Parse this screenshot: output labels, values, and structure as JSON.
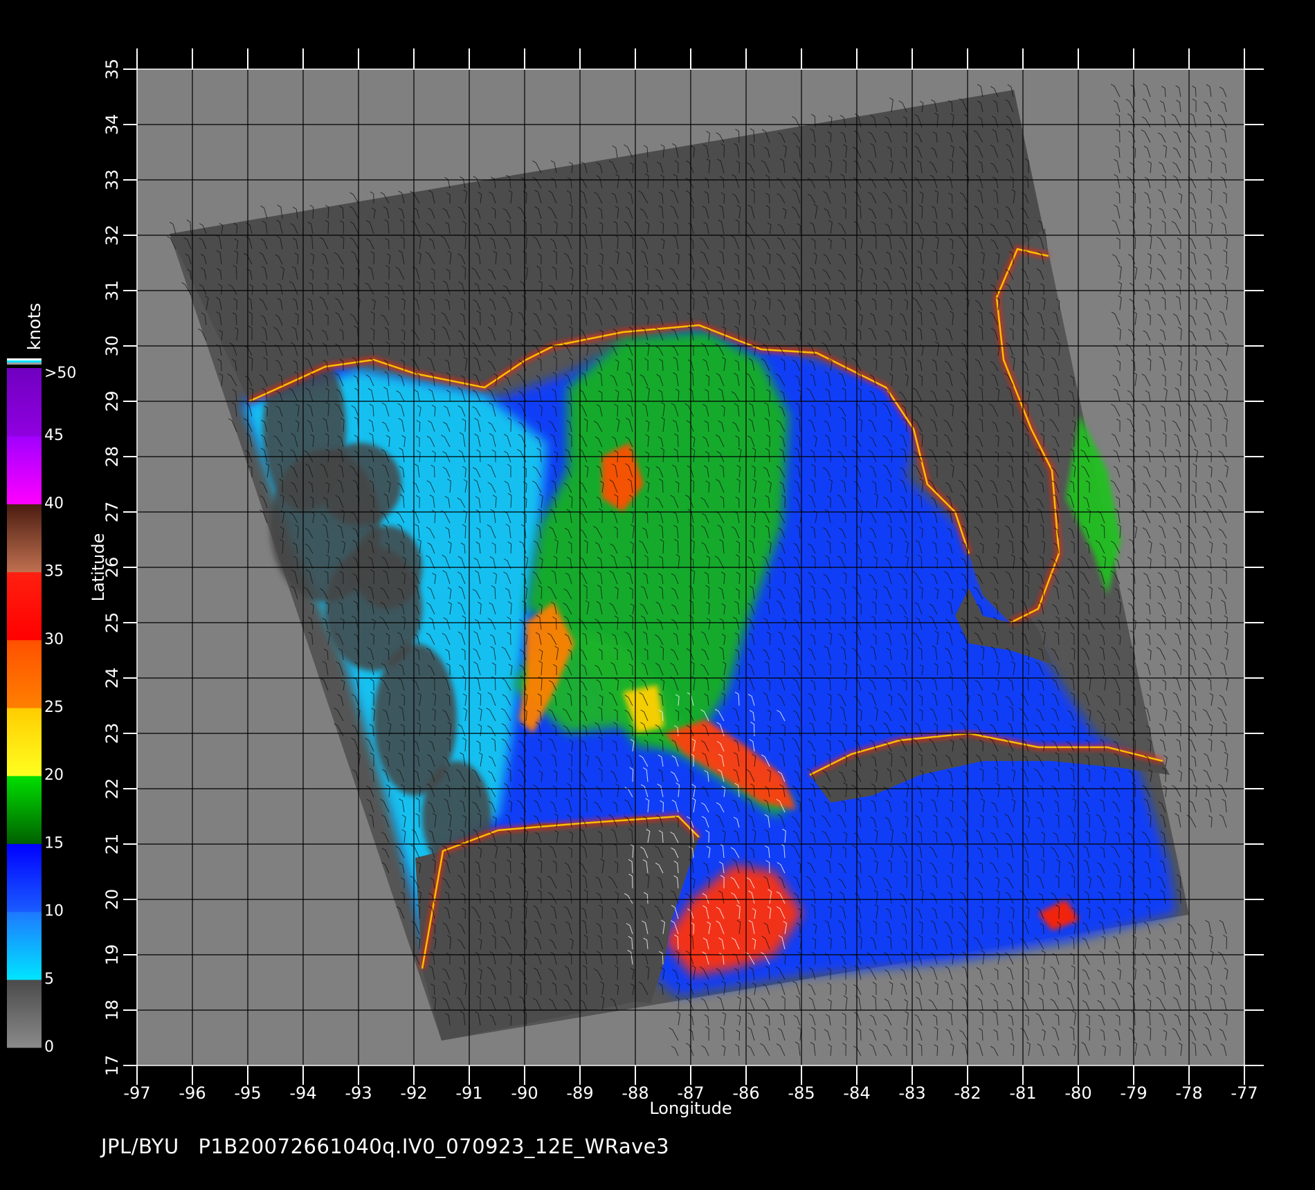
{
  "map": {
    "x_axis_label": "Longitude",
    "y_axis_label": "Latitude",
    "longitudes": [
      -97,
      -96,
      -95,
      -94,
      -93,
      -92,
      -91,
      -90,
      -89,
      -88,
      -87,
      -86,
      -85,
      -84,
      -83,
      -82,
      -81,
      -80,
      -79,
      -78,
      -77
    ],
    "latitudes": [
      17,
      18,
      19,
      20,
      21,
      22,
      23,
      24,
      25,
      26,
      27,
      28,
      29,
      30,
      31,
      32,
      33,
      34,
      35
    ],
    "lon_range": [
      -97,
      -77
    ],
    "lat_range": [
      17,
      35
    ],
    "background_color": "#808080",
    "swath_color": "#555555",
    "land_color": "#4c4c4c",
    "grid_color": "#000000"
  },
  "colorbar": {
    "unit_label": "knots",
    "ticks": [
      "0",
      "5",
      "10",
      "15",
      "20",
      "25",
      "30",
      "35",
      "40",
      "45",
      ">50"
    ],
    "bands": [
      {
        "from": 0,
        "to": 5,
        "top": "#4a4a4a",
        "bottom": "#8a8a8a"
      },
      {
        "from": 5,
        "to": 10,
        "top": "#1e78ff",
        "bottom": "#00e5ff"
      },
      {
        "from": 10,
        "to": 15,
        "top": "#0000ff",
        "bottom": "#1a5cff"
      },
      {
        "from": 15,
        "to": 20,
        "top": "#00e000",
        "bottom": "#006000"
      },
      {
        "from": 20,
        "to": 25,
        "top": "#ffcc00",
        "bottom": "#ffff20"
      },
      {
        "from": 25,
        "to": 30,
        "top": "#ff5000",
        "bottom": "#ff8000"
      },
      {
        "from": 30,
        "to": 35,
        "top": "#ff2010",
        "bottom": "#ff0000"
      },
      {
        "from": 35,
        "to": 40,
        "top": "#4a1c10",
        "bottom": "#c07050"
      },
      {
        "from": 40,
        "to": 45,
        "top": "#a000ff",
        "bottom": "#ff00ff"
      },
      {
        "from": 45,
        "to": 50,
        "top": "#7000c0",
        "bottom": "#9000e0"
      }
    ]
  },
  "footer": {
    "source": "JPL/BYU",
    "file_id": "P1B20072661040q.IV0_070923_12E_WRave3"
  }
}
